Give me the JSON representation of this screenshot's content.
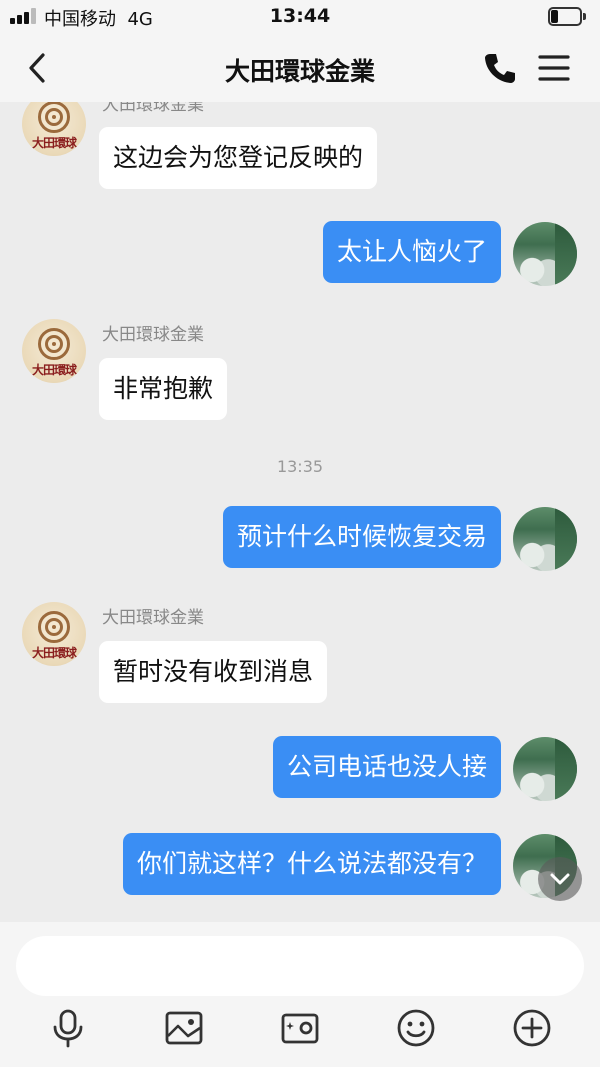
{
  "status_bar": {
    "carrier": "中国移动",
    "network": "4G",
    "time": "13:44",
    "battery_level": 0.25
  },
  "nav": {
    "title": "大田環球金業",
    "icons": [
      "back-chevron-icon",
      "phone-icon",
      "menu-icon"
    ]
  },
  "colors": {
    "outgoing_bubble": "#3a8ef4",
    "incoming_bubble": "#ffffff",
    "background": "#ececec"
  },
  "avatar_logo_text": "大田環球",
  "messages": [
    {
      "direction": "in",
      "sender": "大田環球金業",
      "text": "这边会为您登记反映的"
    },
    {
      "direction": "out",
      "text": "太让人恼火了"
    },
    {
      "direction": "in",
      "sender": "大田環球金業",
      "text": "非常抱歉"
    },
    {
      "divider": "13:35"
    },
    {
      "direction": "out",
      "text": "预计什么时候恢复交易"
    },
    {
      "direction": "in",
      "sender": "大田環球金業",
      "text": "暂时没有收到消息"
    },
    {
      "direction": "out",
      "text": "公司电话也没人接"
    },
    {
      "direction": "out",
      "text": "你们就这样？什么说法都没有？"
    }
  ],
  "input": {
    "value": "",
    "placeholder": ""
  },
  "toolbar": [
    "microphone-icon",
    "image-icon",
    "camera-icon",
    "emoji-icon",
    "plus-icon"
  ]
}
